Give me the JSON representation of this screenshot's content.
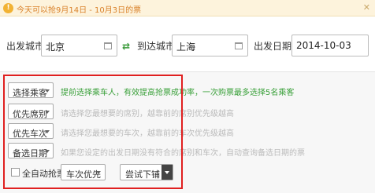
{
  "notice": {
    "text": "今天可以抢9月14日 - 10月3日的票",
    "icon": "bell-icon"
  },
  "search": {
    "from_label": "出发城市",
    "from_value": "北京",
    "to_label": "到达城市",
    "to_value": "上海",
    "date_label": "出发日期",
    "date_value": "2014-10-03"
  },
  "options": [
    {
      "label": "选择乘客",
      "desc": "提前选择乘车人，有效提高抢票成功率，一次购票最多选择5名乘客"
    },
    {
      "label": "优先席别",
      "desc": "请选择您最想要的席别，越靠前的席别优先级越高"
    },
    {
      "label": "优先车次",
      "desc": "请选择您最想要的车次，越靠前的车次优先级越高"
    },
    {
      "label": "备选日期",
      "desc": "如果您设定的出发日期没有符合的席别和车次，自动查询备选日期的票"
    }
  ],
  "bottom": {
    "auto_label": "全自动抢票",
    "priority_select": "车次优先",
    "fallback_select": "尝试下铺"
  },
  "colors": {
    "highlight_border": "#e02020",
    "green_text": "#3aa03a",
    "notice_text": "#d9822b"
  }
}
